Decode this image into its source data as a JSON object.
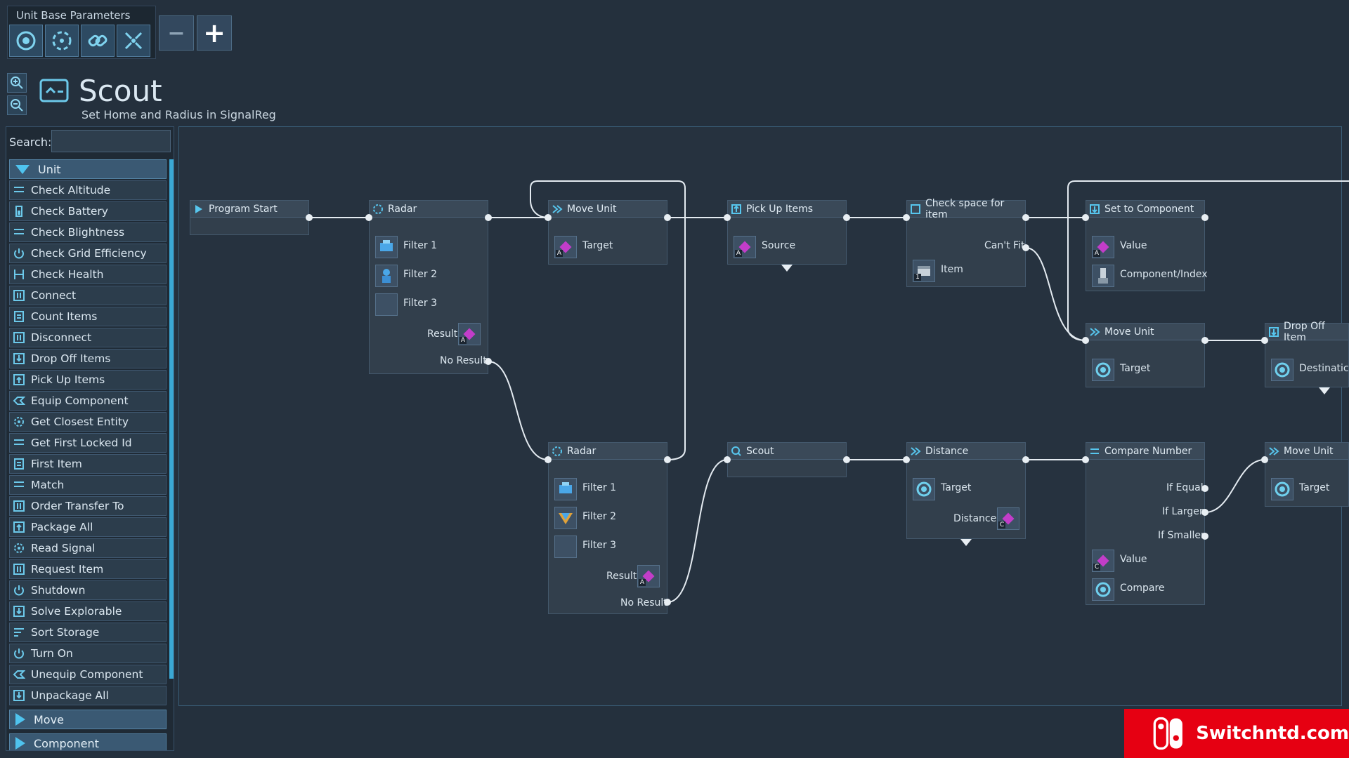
{
  "toolbar": {
    "title": "Unit Base Parameters",
    "params": [
      {
        "icon": "unit-icon"
      },
      {
        "icon": "radar-icon"
      },
      {
        "icon": "link-icon"
      },
      {
        "icon": "scatter-icon"
      }
    ],
    "remove_label": "−",
    "add_label": "+"
  },
  "header": {
    "title": "Scout",
    "subtitle": "Set Home and Radius in SignalReg"
  },
  "sidebar": {
    "search_label": "Search:",
    "search_value": "",
    "category_unit": "Unit",
    "items": [
      {
        "label": "Check Altitude",
        "icon": "lines-icon"
      },
      {
        "label": "Check Battery",
        "icon": "battery-icon"
      },
      {
        "label": "Check Blightness",
        "icon": "lines-icon"
      },
      {
        "label": "Check Grid Efficiency",
        "icon": "power-icon"
      },
      {
        "label": "Check Health",
        "icon": "health-icon"
      },
      {
        "label": "Connect",
        "icon": "connect-icon"
      },
      {
        "label": "Count Items",
        "icon": "count-icon"
      },
      {
        "label": "Disconnect",
        "icon": "connect-icon"
      },
      {
        "label": "Drop Off Items",
        "icon": "download-icon"
      },
      {
        "label": "Pick Up Items",
        "icon": "upload-icon"
      },
      {
        "label": "Equip Component",
        "icon": "equip-icon"
      },
      {
        "label": "Get Closest Entity",
        "icon": "radar-icon"
      },
      {
        "label": "Get First Locked Id",
        "icon": "lines-icon"
      },
      {
        "label": "First Item",
        "icon": "count-icon"
      },
      {
        "label": "Match",
        "icon": "lines-icon"
      },
      {
        "label": "Order Transfer To",
        "icon": "connect-icon"
      },
      {
        "label": "Package All",
        "icon": "upload-icon"
      },
      {
        "label": "Read Signal",
        "icon": "radar-icon"
      },
      {
        "label": "Request Item",
        "icon": "connect-icon"
      },
      {
        "label": "Shutdown",
        "icon": "power-icon"
      },
      {
        "label": "Solve Explorable",
        "icon": "download-icon"
      },
      {
        "label": "Sort Storage",
        "icon": "sort-icon"
      },
      {
        "label": "Turn On",
        "icon": "power-icon"
      },
      {
        "label": "Unequip Component",
        "icon": "equip-icon"
      },
      {
        "label": "Unpackage All",
        "icon": "download-icon"
      }
    ],
    "category_move": "Move",
    "category_component": "Component"
  },
  "nodes": {
    "program_start": {
      "title": "Program Start"
    },
    "radar1": {
      "title": "Radar",
      "filter1": "Filter 1",
      "filter2": "Filter 2",
      "filter3": "Filter 3",
      "result": "Result",
      "no_result": "No Result",
      "badge": "A"
    },
    "move_unit1": {
      "title": "Move Unit",
      "target": "Target",
      "badge": "A"
    },
    "pick_up": {
      "title": "Pick Up Items",
      "source": "Source",
      "badge": "A"
    },
    "check_space": {
      "title": "Check space for item",
      "cant_fit": "Can't Fit",
      "item": "Item",
      "badge": "1"
    },
    "set_component": {
      "title": "Set to Component",
      "value": "Value",
      "component": "Component/Index",
      "badge": "A"
    },
    "move_unit2": {
      "title": "Move Unit",
      "target": "Target"
    },
    "drop_off": {
      "title": "Drop Off Item",
      "destination": "Destinatic"
    },
    "radar2": {
      "title": "Radar",
      "filter1": "Filter 1",
      "filter2": "Filter 2",
      "filter3": "Filter 3",
      "result": "Result",
      "no_result": "No Result",
      "badge": "A"
    },
    "scout": {
      "title": "Scout"
    },
    "distance": {
      "title": "Distance",
      "target": "Target",
      "distance": "Distance",
      "badge": "C"
    },
    "compare": {
      "title": "Compare Number",
      "if_equal": "If Equal",
      "if_larger": "If Larger",
      "if_smaller": "If Smaller",
      "value": "Value",
      "compare": "Compare",
      "badge": "C"
    },
    "move_unit3": {
      "title": "Move Unit",
      "target": "Target"
    }
  },
  "watermark": {
    "text": "Switchntd.com"
  },
  "colors": {
    "background": "#24303d",
    "accent": "#3aa8d4",
    "register": "#c23dc9",
    "logo": "#e60012"
  }
}
